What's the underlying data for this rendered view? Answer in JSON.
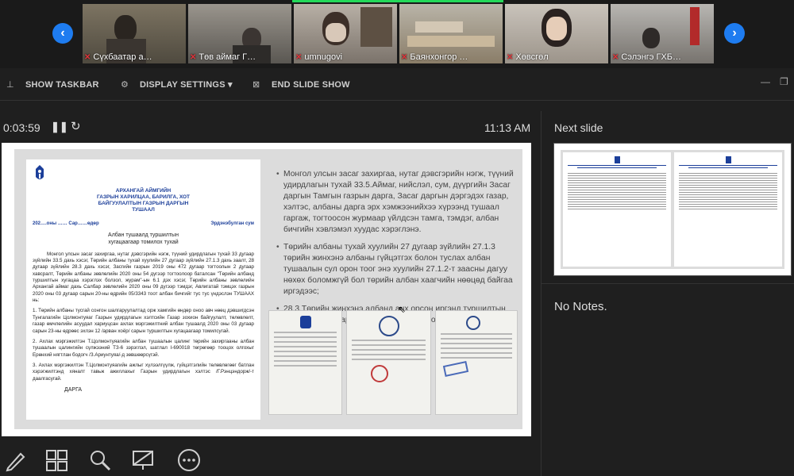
{
  "video_strip": {
    "participants": [
      {
        "name": "Сүхбаатар а…",
        "color": "#8a7a62"
      },
      {
        "name": "Төв аймаг Г…",
        "color": "#6b6f6a"
      },
      {
        "name": "umnugovi",
        "color": "#8f8881"
      },
      {
        "name": "Баянхонгор …",
        "color": "#7d7a70"
      },
      {
        "name": "Хөвсгөл",
        "color": "#a9a29a"
      },
      {
        "name": "Сэлэнгэ  ГХБ…",
        "color": "#8e8c88"
      }
    ],
    "prev_label": "‹",
    "next_label": "›"
  },
  "toolbar": {
    "show_taskbar": "SHOW TASKBAR",
    "display_settings": "DISPLAY SETTINGS ▾",
    "end_slide_show": "END SLIDE SHOW"
  },
  "presenter": {
    "elapsed": "0:03:59",
    "clock": "11:13 AM"
  },
  "slide": {
    "doc": {
      "org": "АРХАНГАЙ АЙМГИЙН\nГАЗРЫН ХАРИЛЦАА, БАРИЛГА, ХОТ\nБАЙГУУЛАЛТЫН ГАЗРЫН ДАРГЫН\nТУШААЛ",
      "date": "202….оны …… Сар……өдөр",
      "place": "Эрдэнэбулган сум",
      "subject": "Албан тушаалд туршилтын\nхугацаагаар томилох тухай",
      "p1": "Монгол улсын засаг захиргаа, нутаг дэвсгэрийн нэгж, түүний удирдлагын тухай 33 дугаар зүйлийн 33.5 дахь хэсэг, Төрийн албаны тухай хуулийн 27 дугаар зүйлийн 27.1.3 дахь заалт, 28 дугаар зүйлийн 28.3 дахь хэсэг, Засгийн газрын 2019 оны 472 дугаар тогтоолын 2 дугаар хавсралт, Төрийн албаны зөвлөлийн 2020 оны 54 дүгээр тогтоолоор баталсан \"Төрийн албанд туршилтын хугацаа хэрэглэх болзол, журам\"-ын 6.1 дэх хэсэг, Төрийн албаны зөвлөлийн Архангай аймаг дахь Салбар зөвлөлийн 2020 оны 09 дүгээр тэмдэг, Авлигатай тэмцэх газрын 2020 оны 03 дугаар сарын 20-ны өдрийн 05/3343 тоот албан бичгийг тус тус үндэслэн ТУШААХ нь:",
      "p2": "1. Төрийн албаны тусгай сонгон шалгаруулалтад орж хамгийн өндөр оноо авч нөөц дэвшигдсэн Тунгалагийн Цолмонтуяаг Газрын удирдлагын хэлтсийн Газар зохион байгуулалт, төлөвлөлт, газар өмчлөлийн асуудал хариуцсан ахлах мэргэжилтний албан тушаалд 2020 оны 03 дугаар сарын 23-ны өдрөөс эхлэн 12 /арван хоёр/ сарын туршилтын хугацаагаар томилсугай.",
      "p3": "2. Ахлах мэргэжилтэн Т.Цолмонтуяагийн албан тушаалын цалинг төрийн захиргааны албан тушаалын цалингийн сүлжээний ТЗ-6 зэрэглэл, шатлал I-690018 төгрөгөөр тооцох олгохыг Ерөнхий нягтлан бодогч /З.Ариунтуяа/-д зөвшөөрсүгэй.",
      "p4": "3. Ахлах мэргэжилтэн Т.Цолмонтуяагийн ажлыг хүлээлгүүлж, гүйцэтгэлийн төлөвлөгөөг батлан хэрэгжилтэнд хяналт тавьж ажиллахыг Газрын удирдлагын хэлтэс /Г.Рэнцэндорж/-т даалгасугай.",
      "sign": "ДАРГА"
    },
    "bullets": [
      "Монгол улсын засаг захиргаа, нутаг дэвсгэрийн нэгж, түүний удирдлагын тухай 33.5.Аймаг, нийслэл, сум, дүүргийн Засаг даргын Тамгын газрын дарга, Засаг даргын дэргэдэх газар, хэлтэс, албаны дарга эрх хэмжээнийхээ хүрээнд тушаал гаргаж, тогтоосон журмаар үйлдсэн тамга, тэмдэг, албан бичгийн хэвлэмэл хуудас хэрэглэнэ.",
      "Төрийн албаны тухай хуулийн 27 дугаар зүйлийн 27.1.3 төрийн жинхэнэ албаны гүйцэтгэх болон туслах албан тушаалын сул орон тоог энэ хуулийн 27.1.2-т заасны дагуу нөхөх боломжгүй бол төрийн албан хаагчийн нөөцөд байгаа иргэдээс;",
      "28.3.Төрийн жинхэнэ албанд анх орсон иргэнд туршилтын хугацааг 6-12 сар хүртэл хугацаагаар тогтоож болно."
    ]
  },
  "right_panel": {
    "next_slide_label": "Next slide",
    "notes": "No Notes."
  },
  "colors": {
    "accent_blue": "#1e7cf0",
    "active_speaker": "#23d959",
    "muted_red": "#e0353b",
    "doc_blue": "#1c3f9a"
  }
}
